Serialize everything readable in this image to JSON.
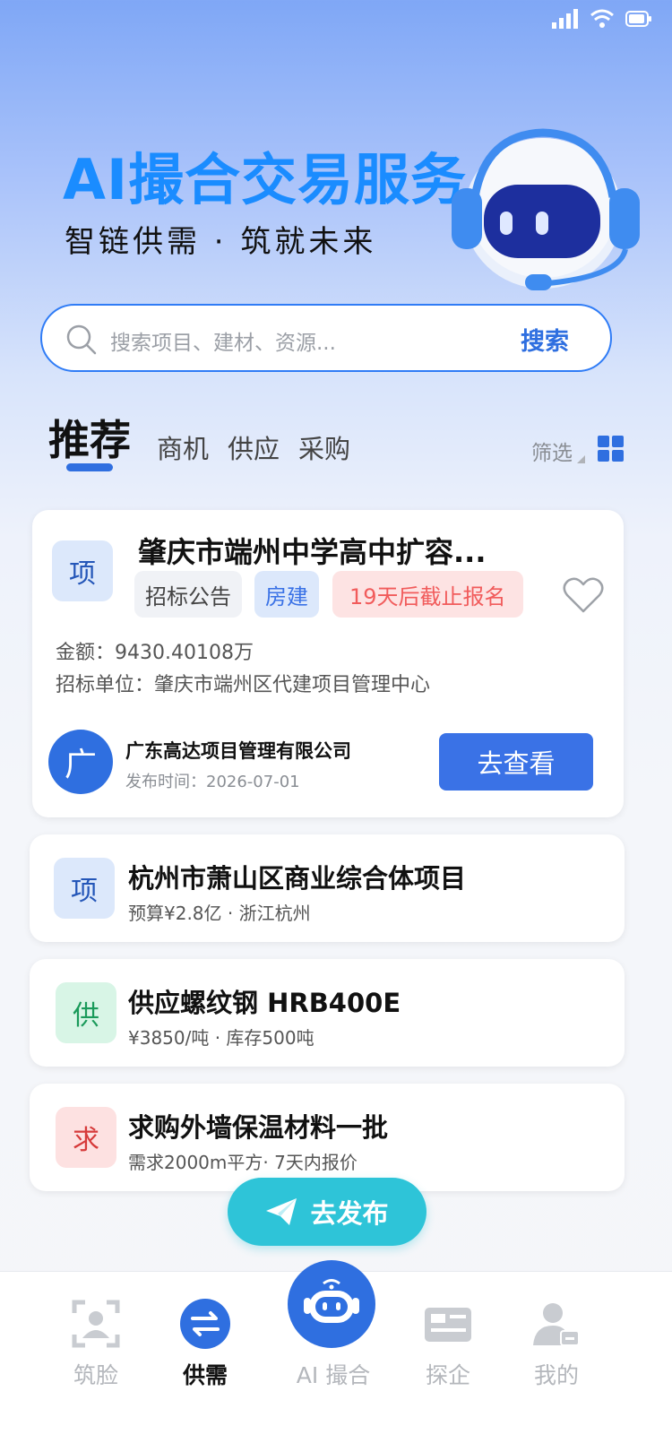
{
  "hero": {
    "title": "AI撮合交易服务",
    "subtitle": "智链供需 · 筑就未来"
  },
  "search": {
    "placeholder": "搜索项目、建材、资源...",
    "button_label": "搜索"
  },
  "tabs": {
    "items": [
      {
        "label": "推荐",
        "active": true
      },
      {
        "label": "商机",
        "active": false
      },
      {
        "label": "供应",
        "active": false
      },
      {
        "label": "采购",
        "active": false
      }
    ],
    "filter_label": "筛选"
  },
  "main_card": {
    "badge": "项",
    "title": "肇庆市端州中学高中扩容...",
    "tags": [
      "招标公告",
      "房建",
      "19天后截止报名"
    ],
    "amount": "金额：9430.40108万",
    "tender_unit": "招标单位：肇庆市端州区代建项目管理中心",
    "company_avatar": "广",
    "company_name": "广东高达项目管理有限公司",
    "publish_time": "发布时间：2026-07-01",
    "action_label": "去查看"
  },
  "list_items": [
    {
      "badge": "项",
      "title": "杭州市萧山区商业综合体项目",
      "subtitle": "预算¥2.8亿 · 浙江杭州"
    },
    {
      "badge": "供",
      "title": "供应螺纹钢 HRB400E",
      "subtitle": "¥3850/吨 · 库存500吨"
    },
    {
      "badge": "求",
      "title": "求购外墙保温材料一批",
      "subtitle": "需求2000m平方· 7天内报价"
    }
  ],
  "publish_button": {
    "label": "去发布",
    "icon": "paper-plane-icon"
  },
  "bottom_nav": {
    "items": [
      {
        "label": "筑脸",
        "icon": "face-scan-icon",
        "active": false
      },
      {
        "label": "供需",
        "icon": "exchange-icon",
        "active": true
      },
      {
        "label": "AI 撮合",
        "icon": "robot-icon",
        "active": false
      },
      {
        "label": "探企",
        "icon": "company-card-icon",
        "active": false
      },
      {
        "label": "我的",
        "icon": "user-icon",
        "active": false
      }
    ]
  },
  "colors": {
    "accent": "#2f6fe0",
    "hero_title": "#1a8cff",
    "publish": "#2ec4d8",
    "deadline_tag": "#f15b5b"
  }
}
